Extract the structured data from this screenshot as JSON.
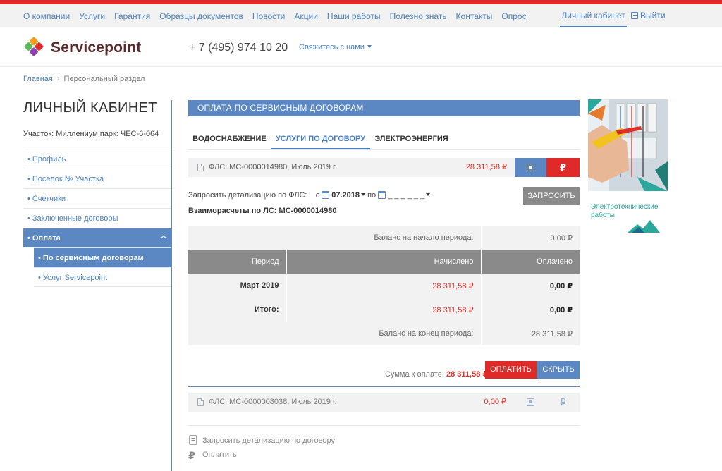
{
  "topnav": {
    "links": [
      "О компании",
      "Услуги",
      "Гарантия",
      "Образцы документов",
      "Новости",
      "Акции",
      "Наши работы",
      "Полезно знать",
      "Контакты",
      "Опрос"
    ],
    "account": "Личный кабинет",
    "logout": "Выйти"
  },
  "header": {
    "logo_text": "Servicepoint",
    "phone": "+ 7 (495) 974 10 20",
    "contact": "Свяжитесь с нами"
  },
  "breadcrumb": {
    "home": "Главная",
    "current": "Персональный раздел"
  },
  "sidebar": {
    "title": "ЛИЧНЫЙ КАБИНЕТ",
    "plot": "Участок: Миллениум парк: ЧЕС-6-064",
    "items": [
      "• Профиль",
      "• Поселок № Участка",
      "• Счетчики",
      "• Заключенные договоры",
      "• Оплата"
    ],
    "subitems": [
      "• По сервисным договорам",
      "• Услуг Servicepoint"
    ]
  },
  "main": {
    "section_title": "ОПЛАТА ПО СЕРВИСНЫМ ДОГОВОРАМ",
    "tabs": [
      "ВОДОСНАБЖЕНИЕ",
      "УСЛУГИ ПО ДОГОВОРУ",
      "ЭЛЕКТРОЭНЕРГИЯ"
    ],
    "fls1": {
      "label": "ФЛС: МС-0000014980, Июль 2019 г.",
      "amount": "28 311,58 ₽"
    },
    "request": {
      "label": "Запросить детализацию по ФЛС:",
      "from_label": "с",
      "from_value": "07.2018",
      "to_label": "по",
      "to_value": "_ _ _ _ _ _",
      "button": "ЗАПРОСИТЬ"
    },
    "settlement_title": "Взаиморасчеты по ЛС: МС-0000014980",
    "table": {
      "opening_label": "Баланс на начало периода:",
      "opening_value": "0,00 ₽",
      "headers": [
        "Период",
        "Начислено",
        "Оплачено"
      ],
      "rows": [
        {
          "period": "Март 2019",
          "charged": "28 311,58 ₽",
          "paid": "0,00 ₽"
        },
        {
          "period": "Итого:",
          "charged": "28 311,58 ₽",
          "paid": "0,00 ₽"
        }
      ],
      "closing_label": "Баланс на конец периода:",
      "closing_value": "28 311,58 ₽"
    },
    "sum_label": "Сумма к оплате:",
    "sum_value": "28 311,58 ₽",
    "pay_button": "ОПЛАТИТЬ",
    "hide_button": "СКРЫТЬ",
    "fls2": {
      "label": "ФЛС: МС-0000008038, Июль 2019 г.",
      "amount": "0,00 ₽"
    },
    "rub_symbol": "₽",
    "footer_actions": [
      "Запросить детализацию по договору",
      "Оплатить"
    ]
  },
  "ad": {
    "text_line1": "Электротехнические",
    "text_line2": "работы"
  },
  "colors": {
    "accent_blue": "#5b88c3",
    "accent_red": "#e02a2a",
    "link_blue": "#4a7fc1"
  }
}
